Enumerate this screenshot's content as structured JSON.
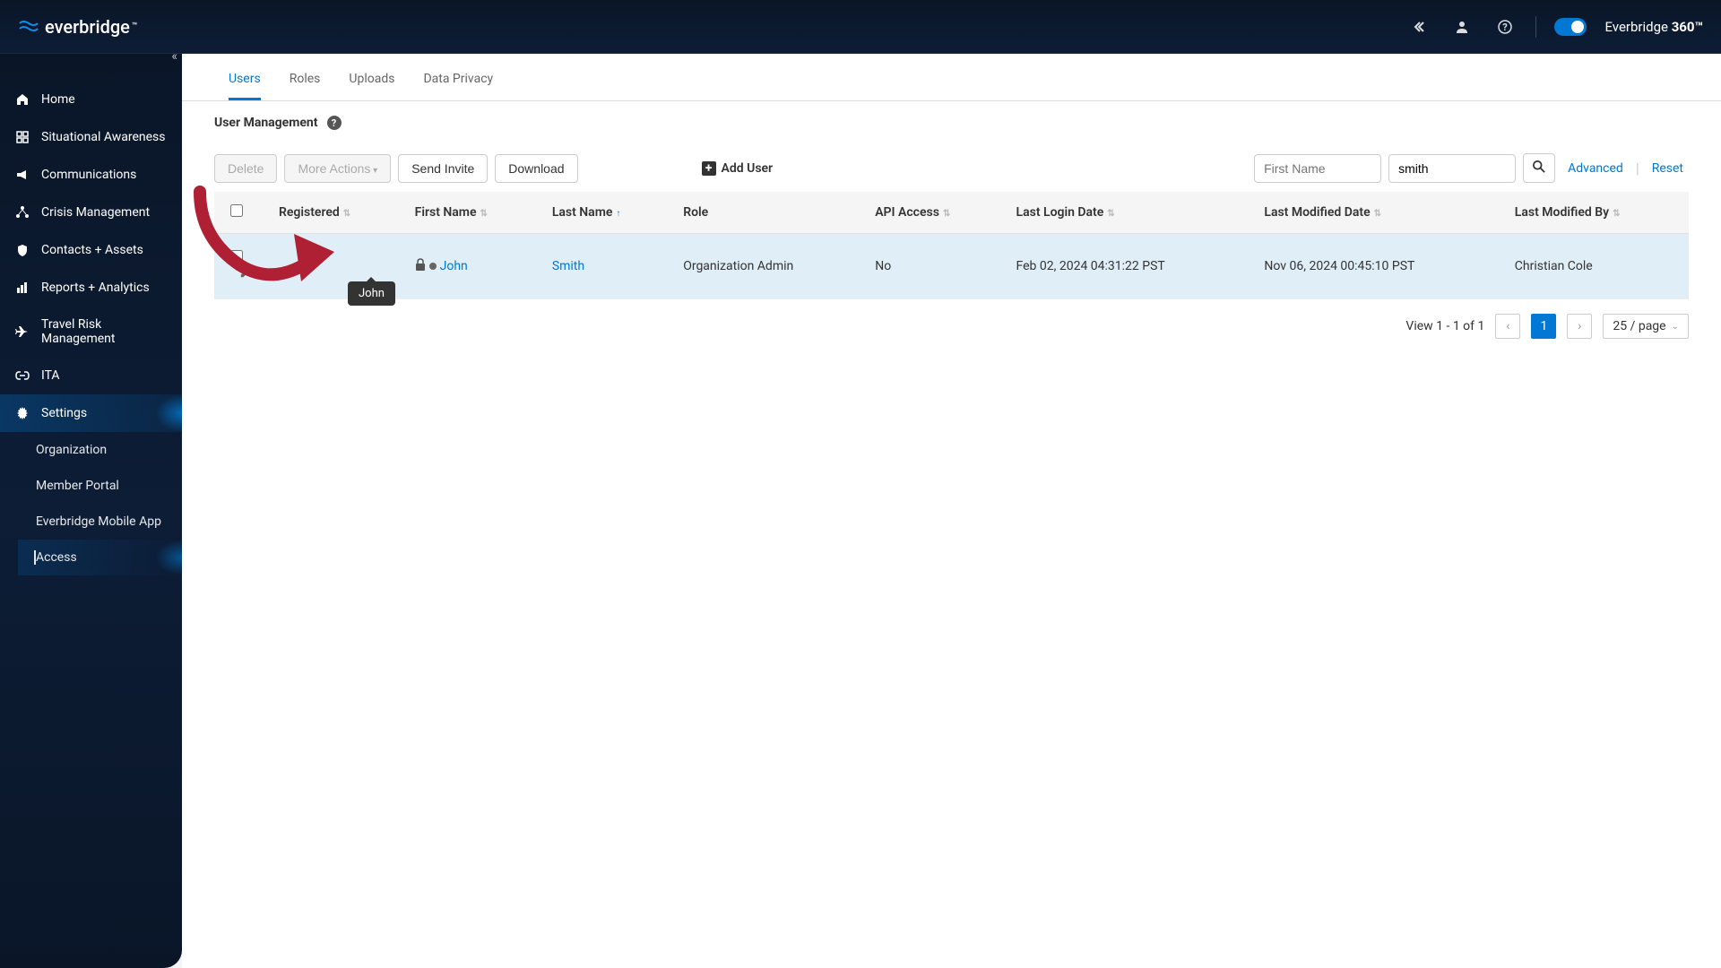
{
  "header": {
    "logo_text": "everbridge",
    "brand_prefix": "Everbridge ",
    "brand_suffix": "360™"
  },
  "sidebar": {
    "items": [
      {
        "icon": "home",
        "label": "Home"
      },
      {
        "icon": "dashboard",
        "label": "Situational Awareness"
      },
      {
        "icon": "megaphone",
        "label": "Communications"
      },
      {
        "icon": "network",
        "label": "Crisis Management"
      },
      {
        "icon": "shield",
        "label": "Contacts + Assets"
      },
      {
        "icon": "chart",
        "label": "Reports + Analytics"
      },
      {
        "icon": "plane",
        "label": "Travel Risk Management"
      },
      {
        "icon": "link",
        "label": "ITA"
      },
      {
        "icon": "gear",
        "label": "Settings"
      }
    ],
    "sub_items": [
      {
        "label": "Organization"
      },
      {
        "label": "Member Portal"
      },
      {
        "label": "Everbridge Mobile App"
      },
      {
        "label": "Access"
      }
    ]
  },
  "tabs": [
    {
      "label": "Users",
      "active": true
    },
    {
      "label": "Roles"
    },
    {
      "label": "Uploads"
    },
    {
      "label": "Data Privacy"
    }
  ],
  "page_title": "User Management",
  "toolbar": {
    "delete": "Delete",
    "more_actions": "More Actions",
    "send_invite": "Send Invite",
    "download": "Download",
    "add_user": "Add User",
    "first_name_placeholder": "First Name",
    "last_name_value": "smith",
    "advanced": "Advanced",
    "reset": "Reset"
  },
  "table": {
    "headers": {
      "registered": "Registered",
      "first_name": "First Name",
      "last_name": "Last Name",
      "role": "Role",
      "api_access": "API Access",
      "last_login": "Last Login Date",
      "last_modified_date": "Last Modified Date",
      "last_modified_by": "Last Modified By"
    },
    "rows": [
      {
        "first_name": "John",
        "last_name": "Smith",
        "role": "Organization Admin",
        "api_access": "No",
        "last_login": "Feb 02, 2024 04:31:22 PST",
        "last_modified_date": "Nov 06, 2024 00:45:10 PST",
        "last_modified_by": "Christian Cole"
      }
    ]
  },
  "tooltip_text": "John",
  "pagination": {
    "view_text": "View 1 - 1 of 1",
    "current_page": "1",
    "page_size": "25 / page"
  }
}
